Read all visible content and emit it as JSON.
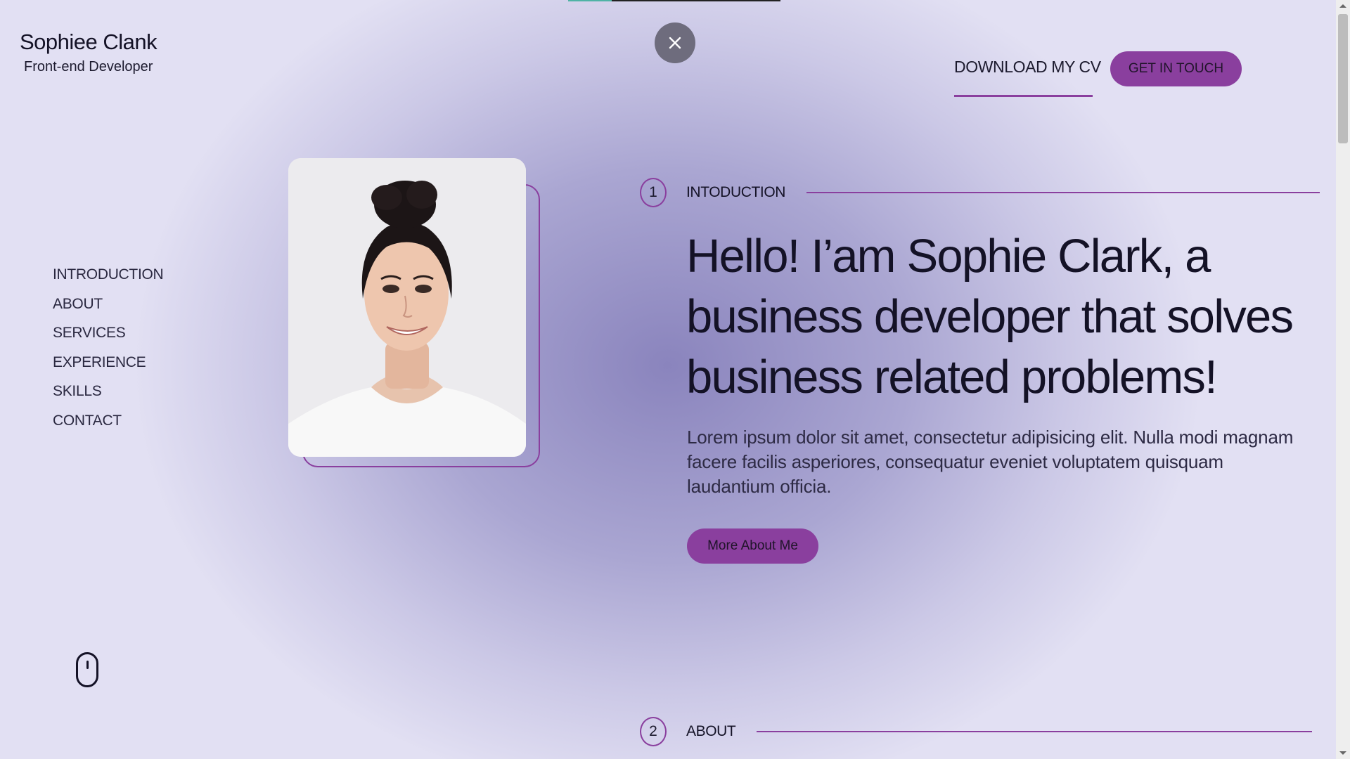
{
  "brand": {
    "name": "Sophiee Clank",
    "role": "Front-end Developer"
  },
  "header": {
    "download_cv": "DOWNLOAD MY CV",
    "get_in_touch": "GET IN TOUCH"
  },
  "nav": {
    "items": [
      {
        "label": "INTRODUCTION"
      },
      {
        "label": "ABOUT"
      },
      {
        "label": "SERVICES"
      },
      {
        "label": "EXPERIENCE"
      },
      {
        "label": "SKILLS"
      },
      {
        "label": "CONTACT"
      }
    ]
  },
  "sections": [
    {
      "number": "1",
      "label": "INTODUCTION"
    },
    {
      "number": "2",
      "label": "ABOUT"
    }
  ],
  "hero": {
    "title": "Hello! I’am Sophie Clark, a business developer that solves business related problems!",
    "text": "Lorem ipsum dolor sit amet, consectetur adipisicing elit. Nulla modi magnam facere facilis asperiores, consequatur eveniet voluptatem quisquam laudantium officia.",
    "button": "More About Me"
  },
  "icons": {
    "close": "close-icon",
    "scroll": "mouse-scroll-icon"
  },
  "colors": {
    "accent": "#8a3f9e",
    "background_center": "#8a84bd",
    "background_edge": "#e2e0f3",
    "close_button": "#6e6c7d",
    "progress": "#4fb3a5"
  }
}
